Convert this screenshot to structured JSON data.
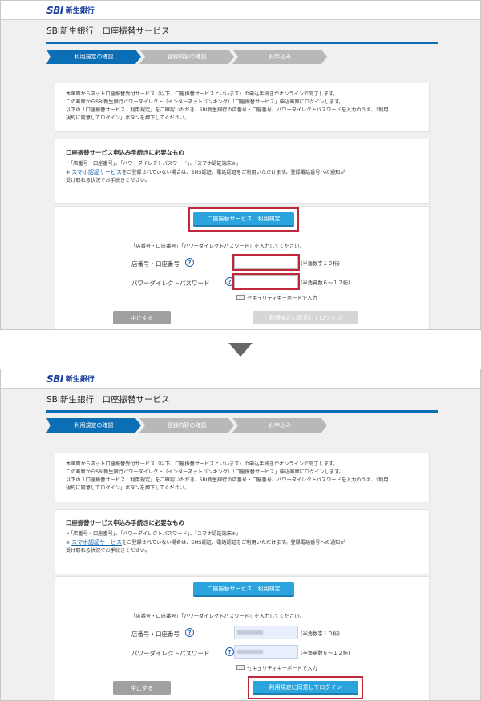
{
  "logo": {
    "mark": "SBI",
    "name": "新生銀行"
  },
  "page_title": "SBI新生銀行　口座振替サービス",
  "steps": [
    "利用規定の確認",
    "登録内容の確認",
    "お申込み"
  ],
  "intro": {
    "line1": "本画面からネット口座振替受付サービス（以下、口座振替サービスといいます）の申込手続きがオンラインで完了します。",
    "line2": "この画面からSBI新生銀行パワーダイレクト（インターネットバンキング）「口座振替サービス」申込画面にログインします。",
    "line3": "以下の「口座振替サービス　利用規定」をご確認いただき、SBI新生銀行の店番号・口座番号、パワーダイレクトパスワードを入力のうえ、「利用",
    "line4": "規約に同意してログイン」ボタンを押下してください。"
  },
  "requirements": {
    "heading": "口座振替サービス申込み手続きに必要なもの",
    "item1": "・「店番号・口座番号」、「パワーダイレクトパスワード」、「スマホ認証端末※」",
    "note_prefix": "※",
    "note_link": "スマホ認証サービス",
    "note_rest": "をご登録されていない場合は、SMS認証、電話認証をご利用いただけます。登録電話番号への通知が",
    "note_line2": "受け取れる状況でお手続きください。"
  },
  "terms_button": "口座振替サービス　利用規定",
  "instruction": "「店番号・口座番号」「パワーダイレクトパスワード」を入力してください。",
  "fields": {
    "account_label": "店番号・口座番号",
    "account_hint": "(半角数字１０桁)",
    "password_label": "パワーダイレクトパスワード",
    "password_hint": "(半角英数６～１２桁)",
    "security_kb": "セキュリティキーボードで入力",
    "help": "?"
  },
  "cancel_button": "中止する",
  "login_button": "利用規定に同意してログイン",
  "colors": {
    "brand": "#0c6fb6",
    "button_blue": "#2ba3dc",
    "highlight": "#c1273b"
  }
}
